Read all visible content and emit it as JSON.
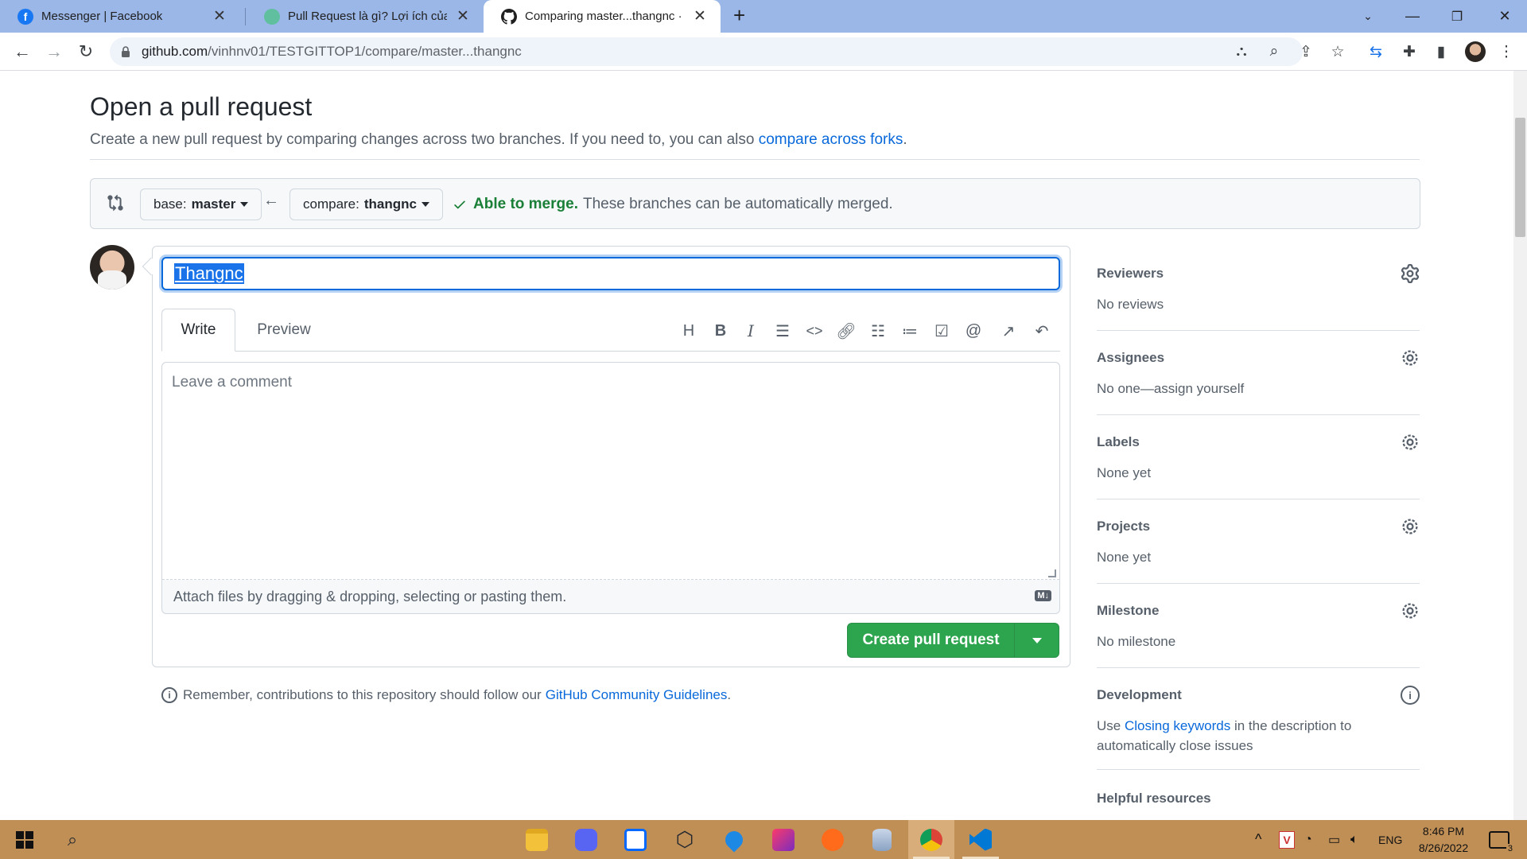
{
  "browser": {
    "tabs": [
      {
        "title": "Messenger | Facebook",
        "favicon": "facebook-icon",
        "active": false
      },
      {
        "title": "Pull Request là gì? Lợi ích của Pu",
        "favicon": "globe-icon",
        "active": false
      },
      {
        "title": "Comparing master...thangnc · vin",
        "favicon": "github-icon",
        "active": true
      }
    ],
    "address": {
      "host": "github.com",
      "path": "/vinhnv01/TESTGITTOP1/compare/master...thangnc"
    }
  },
  "page": {
    "title": "Open a pull request",
    "subtitle": "Create a new pull request by comparing changes across two branches. If you need to, you can also",
    "subtitle_link": "compare across forks",
    "subtitle_end": "."
  },
  "range": {
    "base_label": "base:",
    "base_value": "master",
    "compare_label": "compare:",
    "compare_value": "thangnc",
    "merge_status": "Able to merge.",
    "merge_detail": "These branches can be automatically merged."
  },
  "composer": {
    "title_value": "Thangnc",
    "tab_write": "Write",
    "tab_preview": "Preview",
    "comment_placeholder": "Leave a comment",
    "attach_text": "Attach files by dragging & dropping, selecting or pasting them.",
    "md_badge": "M↓",
    "submit_label": "Create pull request"
  },
  "remember": {
    "text": "Remember, contributions to this repository should follow our",
    "link": "GitHub Community Guidelines",
    "end": "."
  },
  "sidebar": {
    "reviewers": {
      "head": "Reviewers",
      "value": "No reviews"
    },
    "assignees": {
      "head": "Assignees",
      "value": "No one—assign yourself"
    },
    "labels": {
      "head": "Labels",
      "value": "None yet"
    },
    "projects": {
      "head": "Projects",
      "value": "None yet"
    },
    "milestone": {
      "head": "Milestone",
      "value": "No milestone"
    },
    "development": {
      "head": "Development",
      "pre": "Use",
      "link": "Closing keywords",
      "post": "in the description to automatically close issues"
    },
    "helpful": {
      "head": "Helpful resources"
    }
  },
  "taskbar": {
    "language": "ENG",
    "time": "8:46 PM",
    "date": "8/26/2022",
    "notifications": "3"
  },
  "colors": {
    "accent": "#0969da",
    "success": "#2da44e",
    "taskbar": "#c08f56",
    "tabbar": "#9bb7e8"
  }
}
